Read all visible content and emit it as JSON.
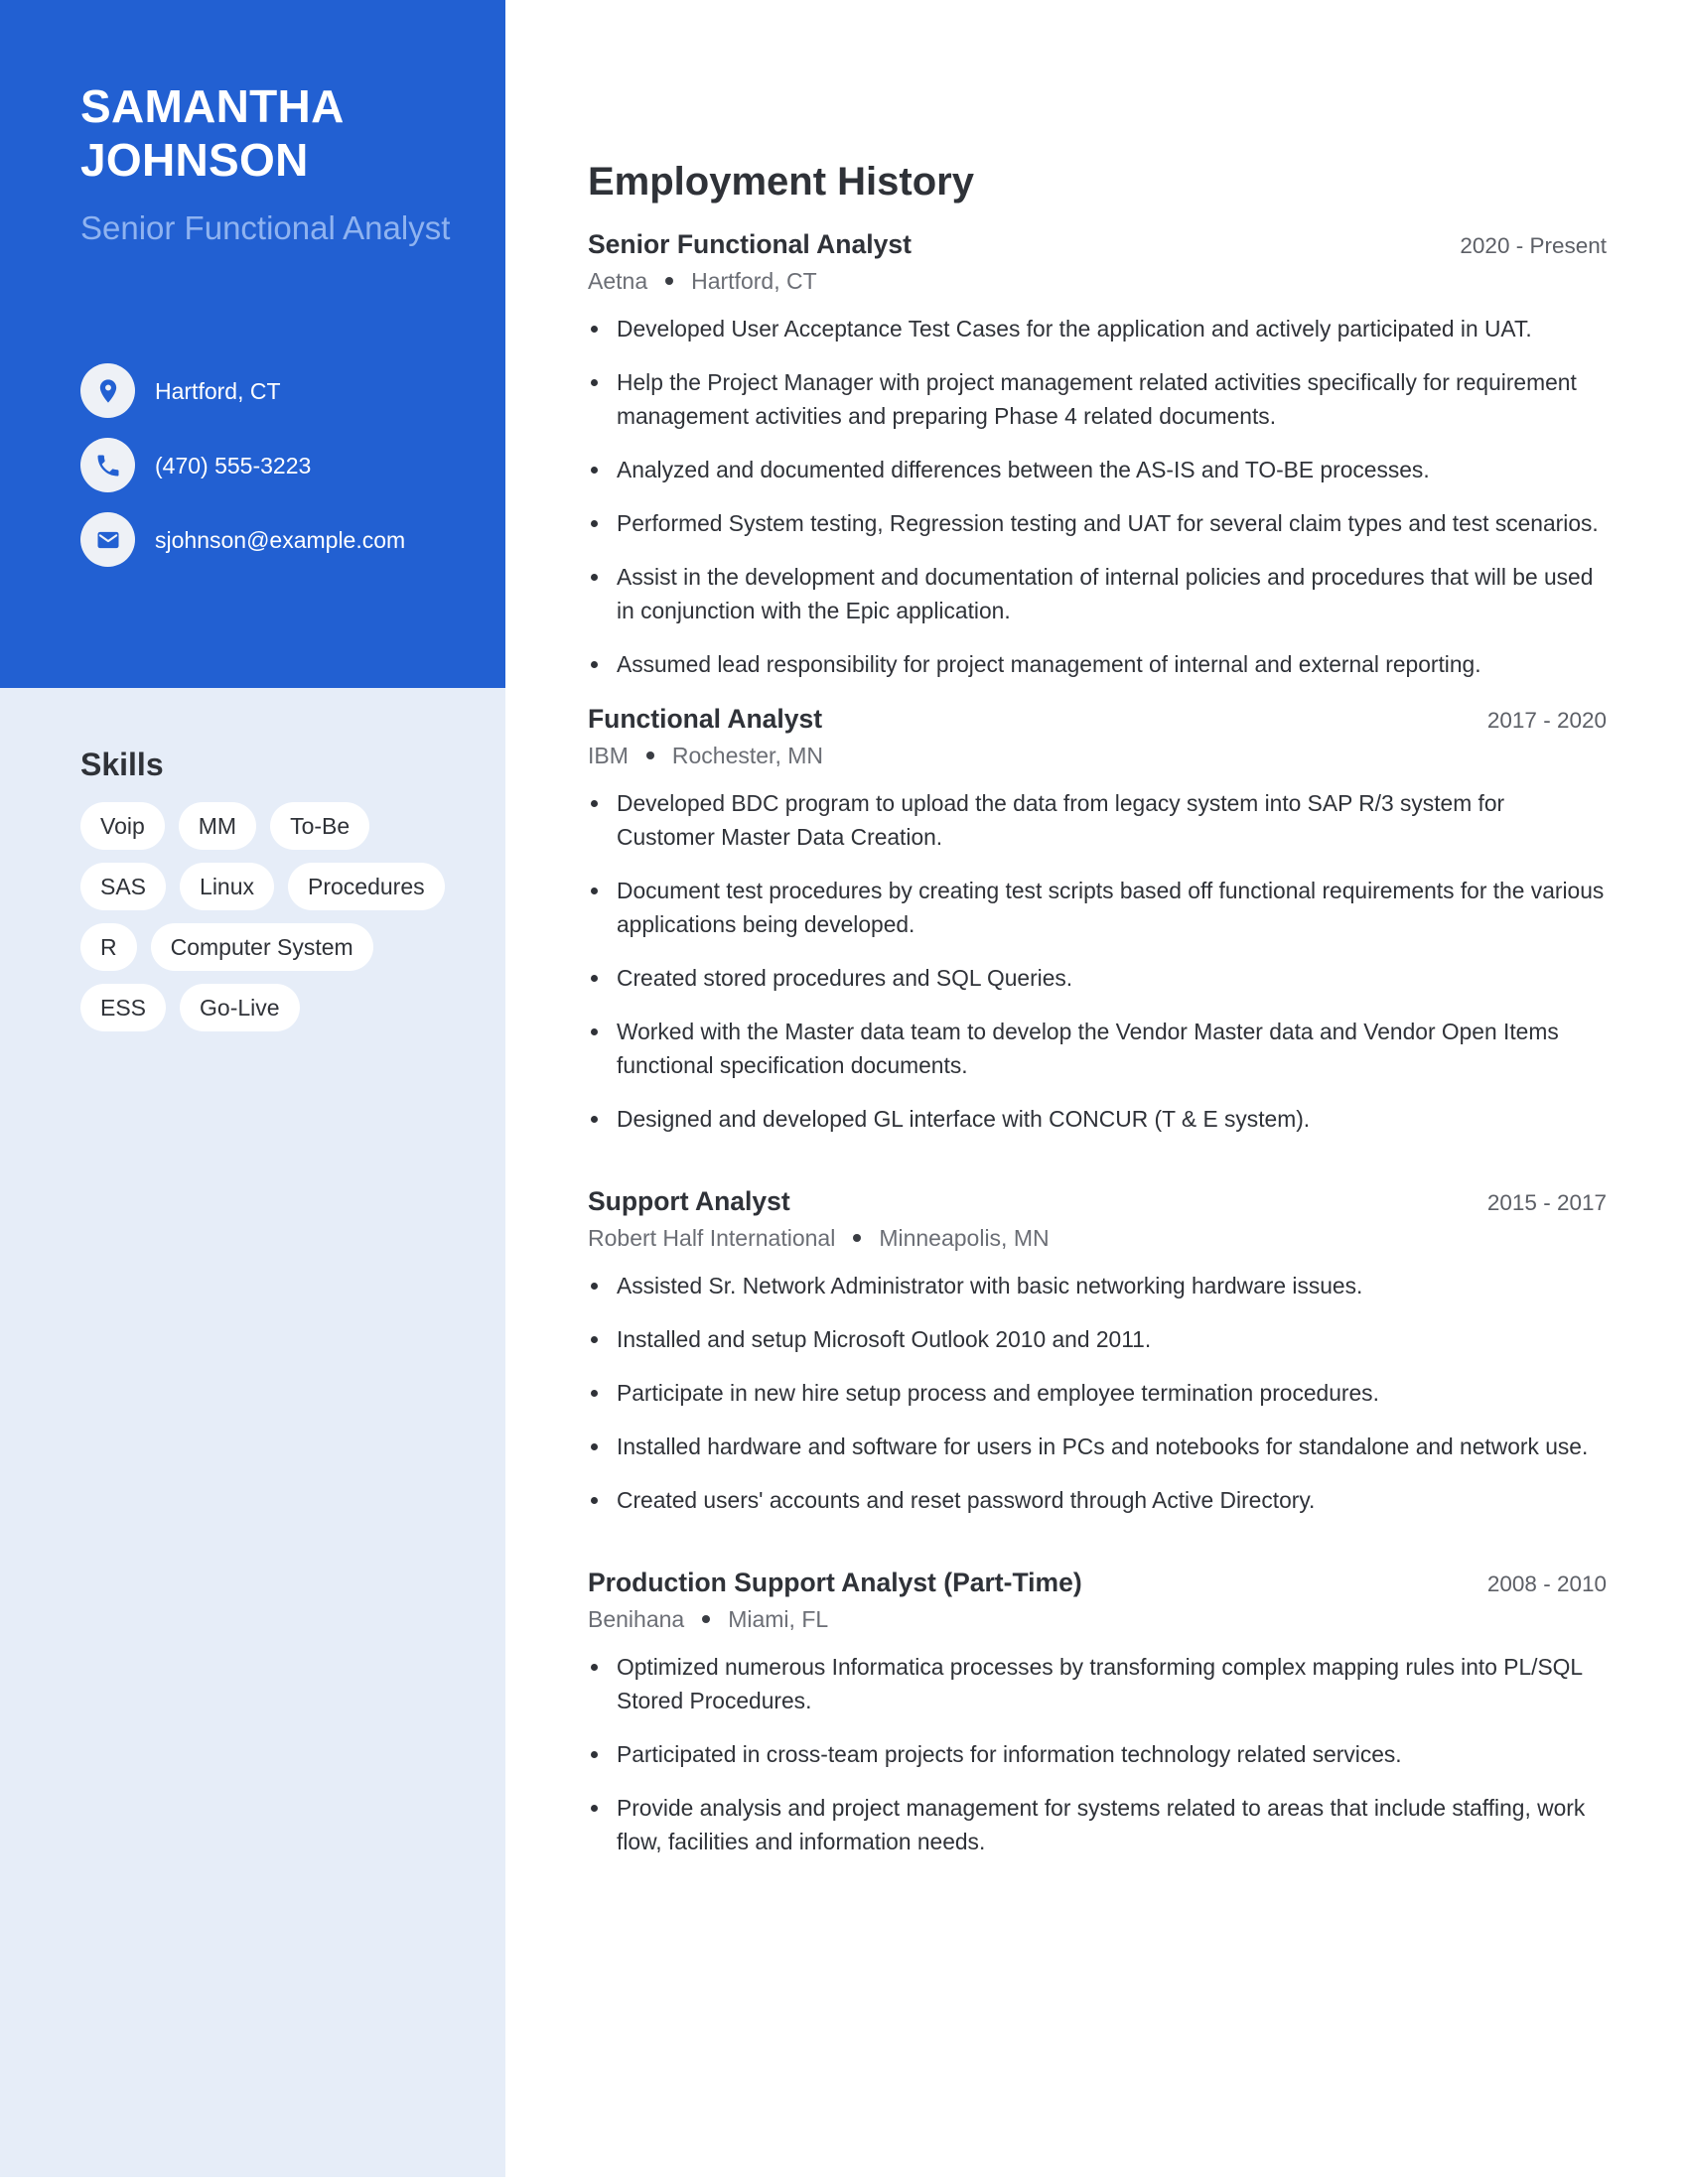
{
  "profile": {
    "name": "SAMANTHA JOHNSON",
    "headline": "Senior Functional Analyst",
    "contacts": [
      {
        "icon": "map-pin-icon",
        "text": "Hartford, CT"
      },
      {
        "icon": "phone-icon",
        "text": "(470) 555-3223"
      },
      {
        "icon": "envelope-icon",
        "text": "sjohnson@example.com"
      }
    ]
  },
  "skills": {
    "title": "Skills",
    "items": [
      "Voip",
      "MM",
      "To-Be",
      "SAS",
      "Linux",
      "Procedures",
      "R",
      "Computer System",
      "ESS",
      "Go-Live"
    ]
  },
  "employment": {
    "title": "Employment History",
    "jobs": [
      {
        "title": "Senior Functional Analyst",
        "dates": "2020 - Present",
        "company": "Aetna",
        "location": "Hartford, CT",
        "bullets": [
          "Developed User Acceptance Test Cases for the application and actively participated in UAT.",
          "Help the Project Manager with project management related activities specifically for requirement management activities and preparing Phase 4 related documents.",
          "Analyzed and documented differences between the AS-IS and TO-BE processes.",
          "Performed System testing, Regression testing and UAT for several claim types and test scenarios.",
          "Assist in the development and documentation of internal policies and procedures that will be used in conjunction with the Epic application.",
          "Assumed lead responsibility for project management of internal and external reporting."
        ]
      },
      {
        "title": "Functional Analyst",
        "dates": "2017 - 2020",
        "company": "IBM",
        "location": "Rochester, MN",
        "bullets": [
          "Developed BDC program to upload the data from legacy system into SAP R/3 system for Customer Master Data Creation.",
          "Document test procedures by creating test scripts based off functional requirements for the various applications being developed.",
          "Created stored procedures and SQL Queries.",
          "Worked with the Master data team to develop the Vendor Master data and Vendor Open Items functional specification documents.",
          "Designed and developed GL interface with CONCUR (T & E system)."
        ]
      },
      {
        "title": "Support Analyst",
        "dates": "2015 - 2017",
        "company": "Robert Half International",
        "location": "Minneapolis, MN",
        "bullets": [
          "Assisted Sr. Network Administrator with basic networking hardware issues.",
          "Installed and setup Microsoft Outlook 2010 and 2011.",
          "Participate in new hire setup process and employee termination procedures.",
          "Installed hardware and software for users in PCs and notebooks for standalone and network use.",
          "Created users' accounts and reset password through Active Directory."
        ]
      },
      {
        "title": "Production Support Analyst (Part-Time)",
        "dates": "2008 - 2010",
        "company": "Benihana",
        "location": "Miami, FL",
        "bullets": [
          "Optimized numerous Informatica processes by transforming complex mapping rules into PL/SQL Stored Procedures.",
          "Participated in cross-team projects for information technology related services.",
          "Provide analysis and project management for systems related to areas that include staffing, work flow, facilities and information needs."
        ]
      }
    ]
  },
  "colors": {
    "brand_blue": "#2260D2",
    "sidebar_light": "#E6EDF8",
    "headline_blue": "#8FB3F0",
    "text_dark": "#2F3238",
    "text_muted": "#6B6E75"
  }
}
